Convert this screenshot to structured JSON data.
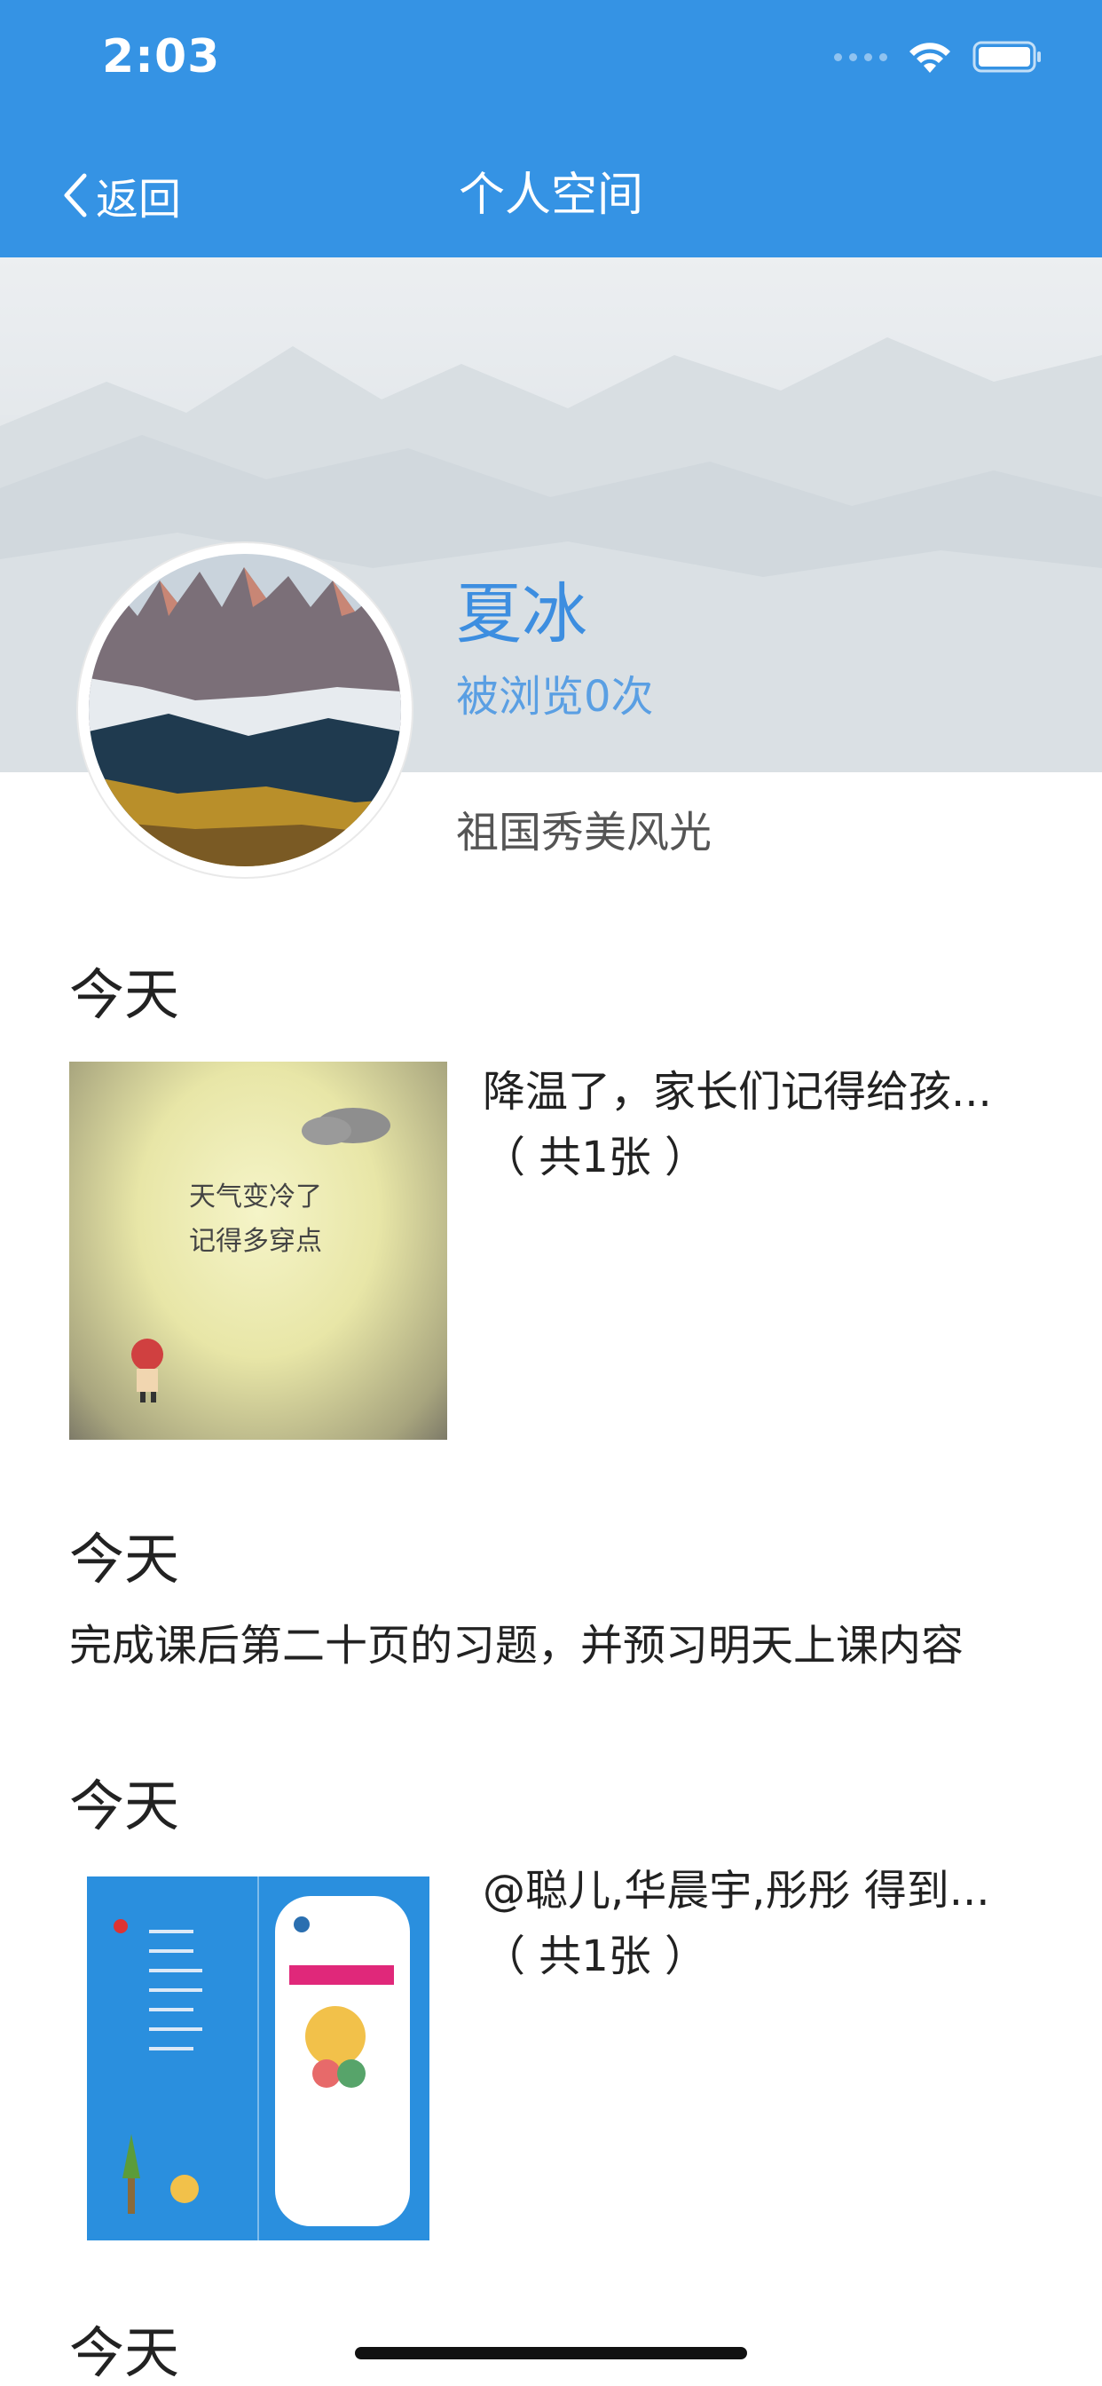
{
  "status_bar": {
    "time": "2:03"
  },
  "nav": {
    "back_label": "返回",
    "title": "个人空间"
  },
  "profile": {
    "name": "夏冰",
    "views": "被浏览0次",
    "motto": "祖国秀美风光"
  },
  "posts": [
    {
      "date": "今天",
      "text": "降温了，家长们记得给孩...",
      "count": "（ 共1张 ）",
      "image_text": [
        "天气变冷了",
        "记得多穿点"
      ]
    },
    {
      "date": "今天",
      "text": "完成课后第二十页的习题，并预习明天上课内容"
    },
    {
      "date": "今天",
      "text": "@聪儿,华晨宇,彤彤 得到...",
      "count": "（ 共1张 ）"
    },
    {
      "date": "今天"
    }
  ],
  "colors": {
    "header": "#3593e4",
    "name": "#3d8ee0"
  }
}
